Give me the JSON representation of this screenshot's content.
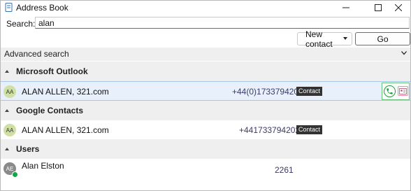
{
  "window": {
    "title": "Address Book",
    "controls": [
      "minimize-icon",
      "maximize-icon",
      "close-icon"
    ]
  },
  "search": {
    "label": "Search:",
    "value": "alan"
  },
  "toolbar": {
    "new_contact_label": "New contact",
    "go_label": "Go"
  },
  "advanced_search": {
    "label": "Advanced search"
  },
  "groups": [
    {
      "title": "Microsoft Outlook",
      "contacts": [
        {
          "initials": "AA",
          "name": "ALAN ALLEN, 321.com",
          "phone": "+44(0)1733794202",
          "badge": "Contact",
          "selected": true
        }
      ]
    },
    {
      "title": "Google Contacts",
      "contacts": [
        {
          "initials": "AA",
          "name": "ALAN ALLEN, 321.com",
          "phone": "+441733794202",
          "badge": "Contact",
          "selected": false
        }
      ]
    },
    {
      "title": "Users",
      "contacts": [
        {
          "initials": "AE",
          "name": "Alan Elston",
          "phone": "2261",
          "presence": "available"
        }
      ]
    }
  ],
  "colors": {
    "group_header_bg": "#efefef",
    "selected_row_bg": "#e8f1fb",
    "badge_bg": "#333333",
    "call_green": "#1f9d3a",
    "presence_green": "#16a34a"
  }
}
